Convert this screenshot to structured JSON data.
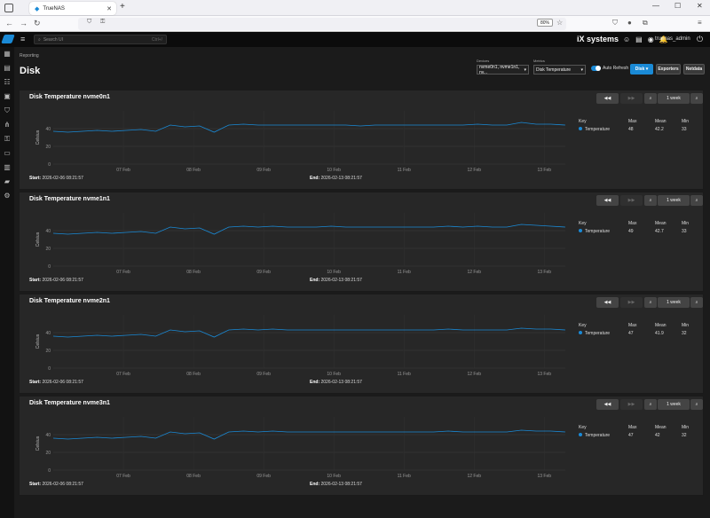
{
  "browser": {
    "tab_title": "TrueNAS",
    "zoom": "80%"
  },
  "app": {
    "search_placeholder": "Search UI",
    "search_hint": "Ctrl+/",
    "brand": "iX systems",
    "user": "truenas_admin"
  },
  "page": {
    "breadcrumb": "Reporting",
    "title": "Disk"
  },
  "filters": {
    "devices_label": "Devices",
    "devices_value": "nvme0n1, nvme1n1, nv...",
    "metrics_label": "Metrics",
    "metrics_value": "Disk Temperature",
    "auto_refresh": "Auto Refresh",
    "disk_btn": "Disk",
    "exporters_btn": "Exporters",
    "netdata_btn": "Netdata"
  },
  "chart_common": {
    "ylabel": "Celsius",
    "zoom_label": "1 week",
    "key_header": "Key",
    "max_header": "Max",
    "mean_header": "Mean",
    "min_header": "Min",
    "series_name": "Temperature",
    "start_label": "Start:",
    "start": "2026-02-06 08:21:57",
    "end_label": "End:",
    "end": "2026-02-13 08:21:57",
    "color": "#1a8ad6"
  },
  "charts": [
    {
      "title": "Disk Temperature nvme0n1",
      "max": "48",
      "mean": "42.2",
      "min": "33"
    },
    {
      "title": "Disk Temperature nvme1n1",
      "max": "49",
      "mean": "42.7",
      "min": "33"
    },
    {
      "title": "Disk Temperature nvme2n1",
      "max": "47",
      "mean": "41.9",
      "min": "32"
    },
    {
      "title": "Disk Temperature nvme3n1",
      "max": "47",
      "mean": "42",
      "min": "32"
    }
  ],
  "chart_data": [
    {
      "type": "line",
      "title": "Disk Temperature nvme0n1",
      "ylabel": "Celsius",
      "ylim": [
        0,
        60
      ],
      "yticks": [
        "0",
        "20",
        "40"
      ],
      "x": [
        "07 Feb",
        "08 Feb",
        "09 Feb",
        "10 Feb",
        "11 Feb",
        "12 Feb",
        "13 Feb"
      ],
      "series": [
        {
          "name": "Temperature",
          "values": [
            37,
            36,
            37,
            38,
            37,
            38,
            39,
            37,
            44,
            42,
            43,
            36,
            44,
            45,
            44,
            44,
            44,
            44,
            44,
            44,
            44,
            43,
            44,
            44,
            44,
            44,
            44,
            44,
            44,
            45,
            44,
            44,
            47,
            45,
            45,
            44
          ]
        }
      ]
    },
    {
      "type": "line",
      "title": "Disk Temperature nvme1n1",
      "ylabel": "Celsius",
      "ylim": [
        0,
        60
      ],
      "yticks": [
        "0",
        "20",
        "40"
      ],
      "x": [
        "07 Feb",
        "08 Feb",
        "09 Feb",
        "10 Feb",
        "11 Feb",
        "12 Feb",
        "13 Feb"
      ],
      "series": [
        {
          "name": "Temperature",
          "values": [
            37,
            36,
            37,
            38,
            37,
            38,
            39,
            37,
            44,
            42,
            43,
            36,
            44,
            45,
            44,
            45,
            44,
            44,
            44,
            45,
            44,
            44,
            44,
            44,
            44,
            44,
            44,
            45,
            44,
            45,
            44,
            44,
            47,
            46,
            45,
            44
          ]
        }
      ]
    },
    {
      "type": "line",
      "title": "Disk Temperature nvme2n1",
      "ylabel": "Celsius",
      "ylim": [
        0,
        60
      ],
      "yticks": [
        "0",
        "20",
        "40"
      ],
      "x": [
        "07 Feb",
        "08 Feb",
        "09 Feb",
        "10 Feb",
        "11 Feb",
        "12 Feb",
        "13 Feb"
      ],
      "series": [
        {
          "name": "Temperature",
          "values": [
            36,
            35,
            36,
            37,
            36,
            37,
            38,
            36,
            43,
            41,
            42,
            35,
            43,
            44,
            43,
            44,
            43,
            43,
            43,
            43,
            43,
            43,
            43,
            43,
            43,
            43,
            43,
            44,
            43,
            43,
            43,
            43,
            45,
            44,
            44,
            43
          ]
        }
      ]
    },
    {
      "type": "line",
      "title": "Disk Temperature nvme3n1",
      "ylabel": "Celsius",
      "ylim": [
        0,
        60
      ],
      "yticks": [
        "0",
        "20",
        "40"
      ],
      "x": [
        "07 Feb",
        "08 Feb",
        "09 Feb",
        "10 Feb",
        "11 Feb",
        "12 Feb",
        "13 Feb"
      ],
      "series": [
        {
          "name": "Temperature",
          "values": [
            36,
            35,
            36,
            37,
            36,
            37,
            38,
            36,
            43,
            41,
            42,
            35,
            43,
            44,
            43,
            44,
            43,
            43,
            43,
            43,
            43,
            43,
            43,
            43,
            43,
            43,
            43,
            44,
            43,
            43,
            43,
            43,
            45,
            44,
            44,
            43
          ]
        }
      ]
    }
  ]
}
